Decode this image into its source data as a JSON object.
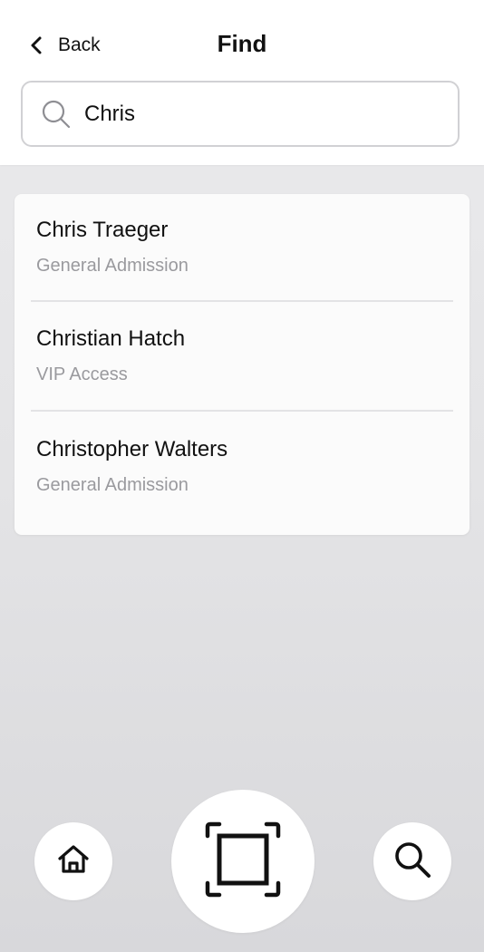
{
  "header": {
    "back_label": "Back",
    "title": "Find"
  },
  "search": {
    "value": "Chris",
    "placeholder": ""
  },
  "results": [
    {
      "name": "Chris Traeger",
      "ticket_type": "General Admission"
    },
    {
      "name": "Christian Hatch",
      "ticket_type": "VIP Access"
    },
    {
      "name": "Christopher Walters",
      "ticket_type": "General Admission"
    }
  ],
  "nav": {
    "home_icon": "home-icon",
    "scan_icon": "scan-icon",
    "search_icon": "search-icon"
  },
  "colors": {
    "text_primary": "#111111",
    "text_secondary": "#9a9a9e",
    "card_bg": "#fbfbfb",
    "page_bg": "#e7e7e9"
  }
}
